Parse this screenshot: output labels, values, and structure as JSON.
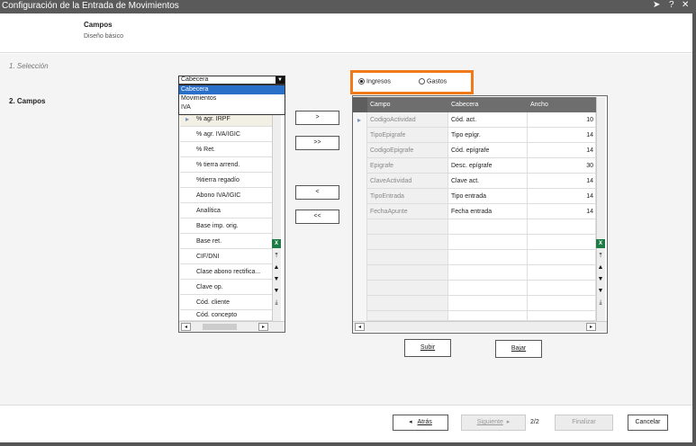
{
  "window": {
    "title": "Configuración de la Entrada de Movimientos",
    "icons": [
      "pin-icon",
      "help-icon",
      "close-icon"
    ],
    "help_glyph": "?",
    "close_glyph": "✕",
    "pin_glyph": "➤"
  },
  "header": {
    "title": "Campos",
    "subtitle": "Diseño básico"
  },
  "steps": [
    {
      "label": "1. Selección",
      "active": false
    },
    {
      "label": "2. Campos",
      "active": true
    }
  ],
  "source": {
    "combo_value": "Cabecera",
    "combo_options": [
      "Cabecera",
      "Movimientos",
      "IVA"
    ],
    "items": [
      "% agr. IRPF",
      "% agr. IVA/IGIC",
      "% Ret.",
      "% tierra arrend.",
      "%tierra regadío",
      "Abono IVA/IGIC",
      "Analítica",
      "Base imp. orig.",
      "Base ret.",
      "CIF/DNI",
      "Clase abono rectifica...",
      "Clave op.",
      "Cód. cliente",
      "Cód. concepto"
    ]
  },
  "move_buttons": {
    "add": ">",
    "add_all": ">>",
    "remove": "<",
    "remove_all": "<<"
  },
  "type_selector": {
    "options": [
      {
        "label": "Ingresos",
        "selected": true
      },
      {
        "label": "Gastos",
        "selected": false
      }
    ]
  },
  "grid": {
    "columns": [
      "Campo",
      "Cabecera",
      "Ancho"
    ],
    "rows": [
      {
        "campo": "CodigoActividad",
        "cabecera": "Cód. act.",
        "ancho": "10"
      },
      {
        "campo": "TipoEpigrafe",
        "cabecera": "Tipo epígr.",
        "ancho": "14"
      },
      {
        "campo": "CodigoEpigrafe",
        "cabecera": "Cód. epígrafe",
        "ancho": "14"
      },
      {
        "campo": "Epigrafe",
        "cabecera": "Desc. epígrafe",
        "ancho": "30"
      },
      {
        "campo": "ClaveActividad",
        "cabecera": "Clave act.",
        "ancho": "14"
      },
      {
        "campo": "TipoEntrada",
        "cabecera": "Tipo entrada",
        "ancho": "14"
      },
      {
        "campo": "FechaApunte",
        "cabecera": "Fecha entrada",
        "ancho": "14"
      }
    ]
  },
  "order_buttons": {
    "up": "Subir",
    "down": "Bajar"
  },
  "footer": {
    "back": "Atrás",
    "next": "Siguiente",
    "page": "2/2",
    "finish": "Finalizar",
    "cancel": "Cancelar"
  }
}
